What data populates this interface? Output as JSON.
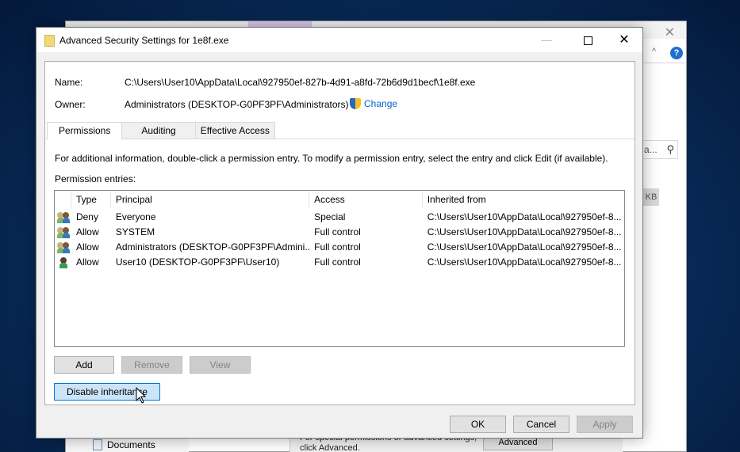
{
  "background_window": {
    "search_placeholder": "a...",
    "size_unit": "KB",
    "nav_item": "Documents",
    "props_text_line1": "For special permissions or advanced settings,",
    "props_text_line2": "click Advanced.",
    "advanced_button": "Advanced",
    "help_glyph": "?",
    "chevron_glyph": "^",
    "close_glyph": "✕"
  },
  "dialog": {
    "title": "Advanced Security Settings for 1e8f.exe",
    "minimize_glyph": "—",
    "close_glyph": "✕",
    "name_label": "Name:",
    "name_value": "C:\\Users\\User10\\AppData\\Local\\927950ef-827b-4d91-a8fd-72b6d9d1becf\\1e8f.exe",
    "owner_label": "Owner:",
    "owner_value": "Administrators (DESKTOP-G0PF3PF\\Administrators)",
    "change_link": "Change",
    "tabs": [
      {
        "label": "Permissions",
        "active": true
      },
      {
        "label": "Auditing",
        "active": false
      },
      {
        "label": "Effective Access",
        "active": false
      }
    ],
    "info_text": "For additional information, double-click a permission entry. To modify a permission entry, select the entry and click Edit (if available).",
    "entries_label": "Permission entries:",
    "columns": [
      "Type",
      "Principal",
      "Access",
      "Inherited from"
    ],
    "entries": [
      {
        "icon": "users-icon",
        "type": "Deny",
        "principal": "Everyone",
        "access": "Special",
        "inherited": "C:\\Users\\User10\\AppData\\Local\\927950ef-8..."
      },
      {
        "icon": "users-icon",
        "type": "Allow",
        "principal": "SYSTEM",
        "access": "Full control",
        "inherited": "C:\\Users\\User10\\AppData\\Local\\927950ef-8..."
      },
      {
        "icon": "users-icon",
        "type": "Allow",
        "principal": "Administrators (DESKTOP-G0PF3PF\\Admini...",
        "access": "Full control",
        "inherited": "C:\\Users\\User10\\AppData\\Local\\927950ef-8..."
      },
      {
        "icon": "user-icon",
        "type": "Allow",
        "principal": "User10 (DESKTOP-G0PF3PF\\User10)",
        "access": "Full control",
        "inherited": "C:\\Users\\User10\\AppData\\Local\\927950ef-8..."
      }
    ],
    "buttons": {
      "add": "Add",
      "remove": "Remove",
      "view": "View",
      "disable_inheritance": "Disable inheritance",
      "ok": "OK",
      "cancel": "Cancel",
      "apply": "Apply"
    }
  }
}
